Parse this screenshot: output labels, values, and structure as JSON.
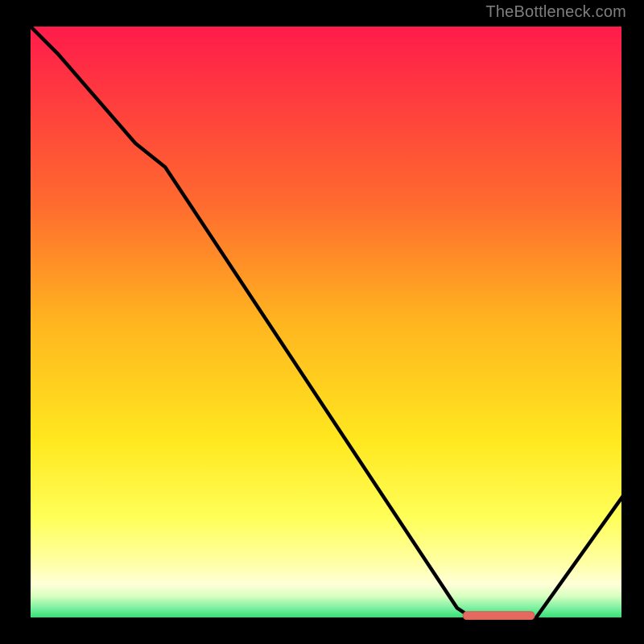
{
  "watermark": {
    "text": "TheBottleneck.com"
  },
  "colors": {
    "bg": "#000000",
    "border": "#000000",
    "watermark": "#7e7e7e",
    "curve": "#000000",
    "marker_fill": "#e46a61",
    "marker_stroke": "#d65a52",
    "grad_top": "#ff1a4c",
    "grad_mid1": "#ff8a1f",
    "grad_mid2": "#ffe81f",
    "grad_lowband": "#ffffa8",
    "grad_green": "#1fdc6a"
  },
  "chart_data": {
    "type": "line",
    "title": "",
    "xlabel": "",
    "ylabel": "",
    "xlim": [
      0,
      100
    ],
    "ylim": [
      0,
      100
    ],
    "series": [
      {
        "name": "bottleneck-curve",
        "x": [
          0,
          5,
          18,
          23,
          72,
          75,
          85,
          100
        ],
        "values": [
          100,
          95,
          80,
          76,
          2,
          0,
          0,
          21
        ]
      }
    ],
    "annotations": [
      {
        "name": "optimal-marker",
        "x_start": 73,
        "x_end": 85,
        "y": 0.7
      }
    ],
    "legend": []
  }
}
